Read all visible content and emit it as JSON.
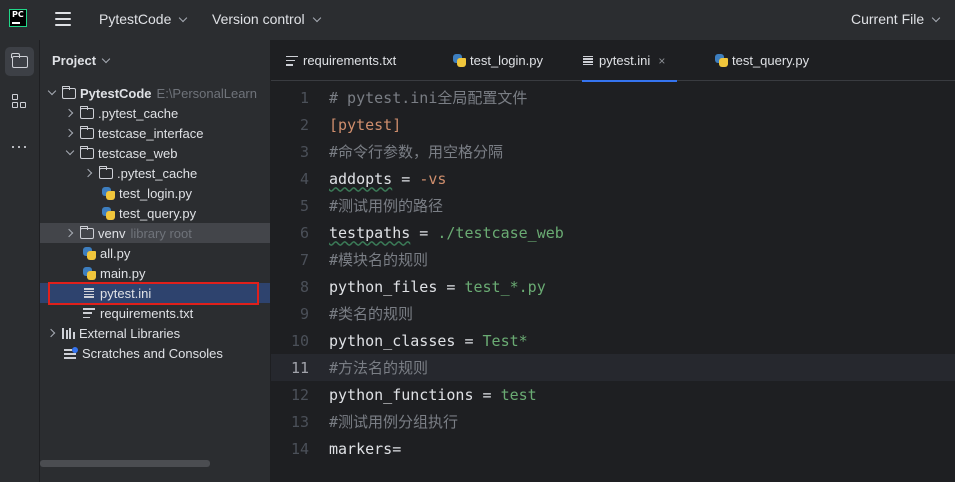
{
  "topbar": {
    "app_logo_text": "PC",
    "menu_icon": "hamburger-menu-icon",
    "project_name": "PytestCode",
    "vcs": "Version control",
    "run_config": "Current File"
  },
  "toolstrip": {
    "items": [
      "folder-icon",
      "structure-icon",
      "more-icon"
    ],
    "more_label": "..."
  },
  "project_panel": {
    "title": "Project",
    "root": {
      "name": "PytestCode",
      "path": "E:\\PersonalLearn"
    },
    "items": [
      {
        "label": "PytestCode",
        "hint": "E:\\PersonalLearn",
        "kind": "folder",
        "expanded": true
      },
      {
        "label": ".pytest_cache",
        "kind": "folder",
        "expanded": false
      },
      {
        "label": "testcase_interface",
        "kind": "folder",
        "expanded": false
      },
      {
        "label": "testcase_web",
        "kind": "folder",
        "expanded": true
      },
      {
        "label": ".pytest_cache",
        "kind": "folder",
        "expanded": false
      },
      {
        "label": "test_login.py",
        "kind": "python"
      },
      {
        "label": "test_query.py",
        "kind": "python"
      },
      {
        "label": "venv",
        "hint": "library root",
        "kind": "folder",
        "expanded": false
      },
      {
        "label": "all.py",
        "kind": "python"
      },
      {
        "label": "main.py",
        "kind": "python"
      },
      {
        "label": "pytest.ini",
        "kind": "ini",
        "selected": true
      },
      {
        "label": "requirements.txt",
        "kind": "text"
      },
      {
        "label": "External Libraries",
        "kind": "library",
        "expanded": false
      },
      {
        "label": "Scratches and Consoles",
        "kind": "scratch"
      }
    ]
  },
  "tabs": [
    {
      "label": "requirements.txt",
      "icon": "text-file-icon",
      "active": false
    },
    {
      "label": "test_login.py",
      "icon": "python-file-icon",
      "active": false
    },
    {
      "label": "pytest.ini",
      "icon": "ini-file-icon",
      "active": true,
      "close": "×"
    },
    {
      "label": "test_query.py",
      "icon": "python-file-icon",
      "active": false
    }
  ],
  "editor": {
    "current_line": 11,
    "lines": [
      {
        "n": "1",
        "text": "# pytest.ini全局配置文件"
      },
      {
        "n": "2",
        "text": "[pytest]"
      },
      {
        "n": "3",
        "text": "#命令行参数，用空格分隔"
      },
      {
        "n": "4",
        "key": "addopts",
        "op": " = ",
        "val": "-vs"
      },
      {
        "n": "5",
        "text": "#测试用例的路径"
      },
      {
        "n": "6",
        "key": "testpaths",
        "op": " = ",
        "val": "./testcase_web"
      },
      {
        "n": "7",
        "text": "#模块名的规则"
      },
      {
        "n": "8",
        "key": "python_files",
        "op": " = ",
        "val": "test_*.py"
      },
      {
        "n": "9",
        "text": "#类名的规则"
      },
      {
        "n": "10",
        "key": "python_classes",
        "op": " = ",
        "val": "Test*"
      },
      {
        "n": "11",
        "text": "#方法名的规则"
      },
      {
        "n": "12",
        "key": "python_functions",
        "op": " = ",
        "val": "test"
      },
      {
        "n": "13",
        "text": "#测试用例分组执行"
      },
      {
        "n": "14",
        "key": "markers",
        "op": "=",
        "val": ""
      }
    ]
  },
  "colors": {
    "accent": "#3574f0",
    "selection_outline": "#e0201b",
    "comment": "#7a7e85",
    "value": "#6aab73",
    "section": "#cf8e6d"
  }
}
